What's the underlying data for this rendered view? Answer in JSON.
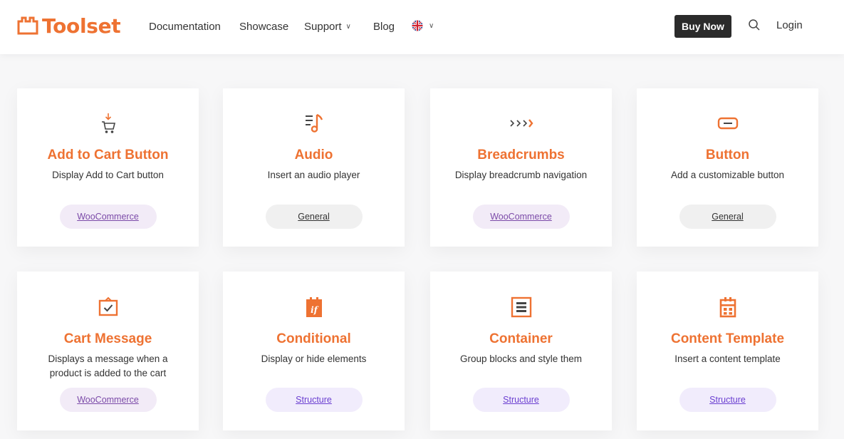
{
  "header": {
    "logo_text": "Toolset",
    "nav": [
      "Documentation",
      "Showcase",
      "Support",
      "Blog"
    ],
    "language_flag": "uk-flag-icon",
    "buy_label": "Buy Now",
    "login_label": "Login"
  },
  "colors": {
    "accent": "#ee7232",
    "woo_tag_bg": "#f2ebf7",
    "woo_tag_text": "#7b4aa8",
    "general_tag_bg": "#f0f0f0",
    "structure_tag_bg": "#f1ecfc",
    "structure_tag_text": "#6b3fd1",
    "buy_button_bg": "#2b2b2b"
  },
  "cards": [
    {
      "icon": "add-to-cart-icon",
      "title": "Add to Cart Button",
      "desc": "Display Add to Cart button",
      "tag": "WooCommerce"
    },
    {
      "icon": "audio-icon",
      "title": "Audio",
      "desc": "Insert an audio player",
      "tag": "General"
    },
    {
      "icon": "breadcrumbs-icon",
      "title": "Breadcrumbs",
      "desc": "Display breadcrumb navigation",
      "tag": "WooCommerce"
    },
    {
      "icon": "button-icon",
      "title": "Button",
      "desc": "Add a customizable button",
      "tag": "General"
    },
    {
      "icon": "cart-message-icon",
      "title": "Cart Message",
      "desc": "Displays a message when a product is added to the cart",
      "tag": "WooCommerce"
    },
    {
      "icon": "conditional-icon",
      "title": "Conditional",
      "desc": "Display or hide elements",
      "tag": "Structure"
    },
    {
      "icon": "container-icon",
      "title": "Container",
      "desc": "Group blocks and style them",
      "tag": "Structure"
    },
    {
      "icon": "content-template-icon",
      "title": "Content Template",
      "desc": "Insert a content template",
      "tag": "Structure"
    }
  ]
}
